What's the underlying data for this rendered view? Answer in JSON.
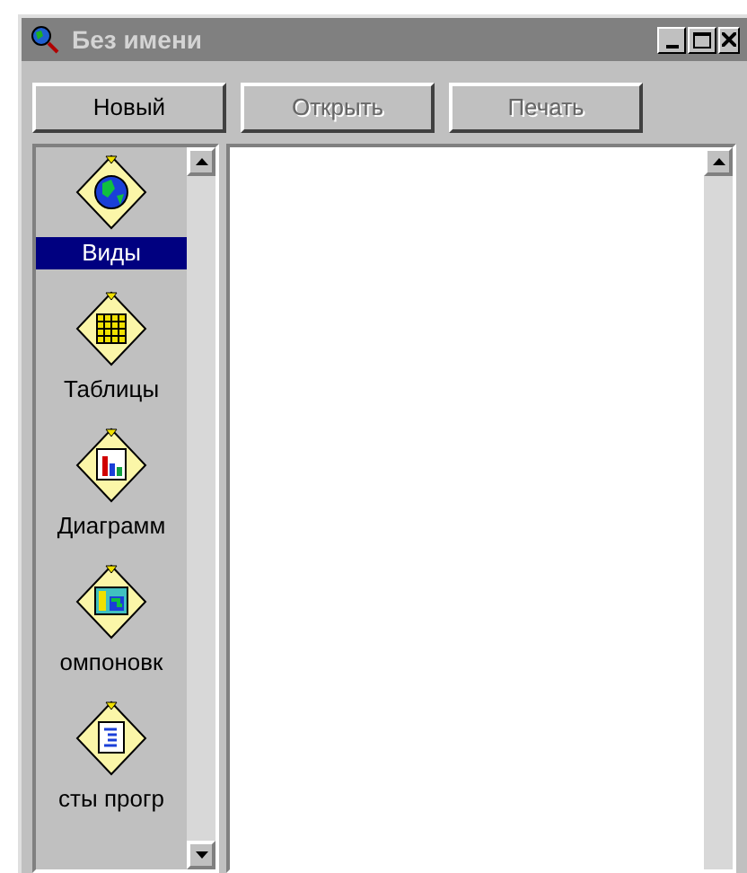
{
  "window": {
    "title": "Без имени",
    "active": false
  },
  "toolbar": [
    {
      "label": "Новый",
      "disabled": false
    },
    {
      "label": "Открыть",
      "disabled": true
    },
    {
      "label": "Печать",
      "disabled": true
    }
  ],
  "sidebar": {
    "items": [
      {
        "kind": "globe",
        "label": "Виды",
        "selected": true
      },
      {
        "kind": "table",
        "label": "Таблицы",
        "selected": false
      },
      {
        "kind": "chart",
        "label": "Диаграмм",
        "selected": false
      },
      {
        "kind": "layout",
        "label": "омпоновк",
        "selected": false
      },
      {
        "kind": "script",
        "label": "сты прогр",
        "selected": false
      }
    ]
  }
}
